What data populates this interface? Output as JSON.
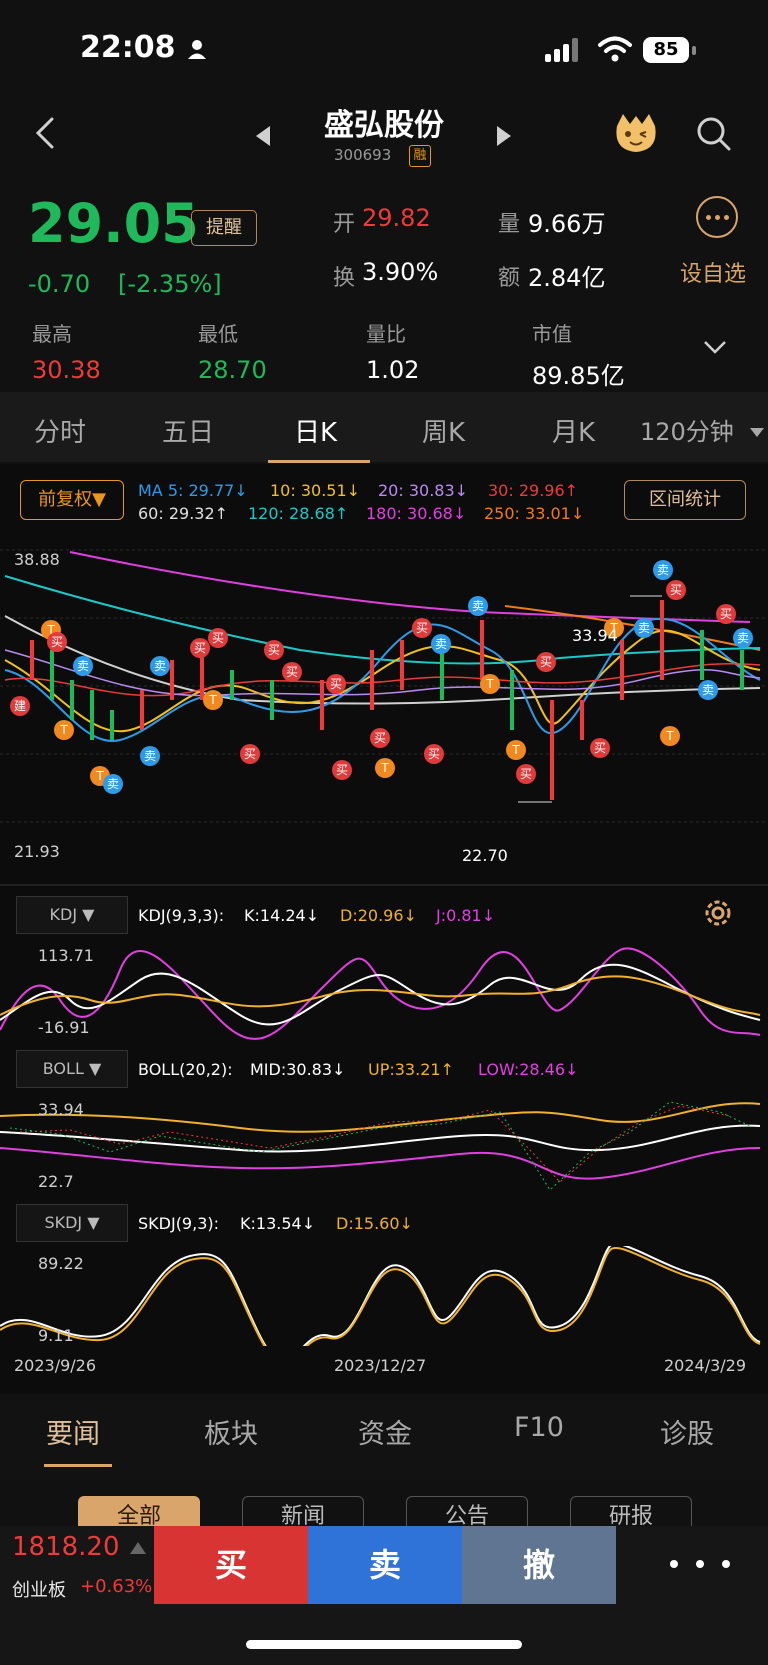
{
  "status_bar": {
    "time": "22:08",
    "battery": "85"
  },
  "header": {
    "name": "盛弘股份",
    "code": "300693",
    "badge": "融"
  },
  "quote": {
    "price": "29.05",
    "alert_label": "提醒",
    "change": "-0.70",
    "change_pct": "[-2.35%]",
    "open_label": "开",
    "open": "29.82",
    "vol_label": "量",
    "vol": "9.66万",
    "turnover_label": "换",
    "turnover": "3.90%",
    "amount_label": "额",
    "amount": "2.84亿",
    "add_watch": "设自选",
    "high_label": "最高",
    "high": "30.38",
    "low_label": "最低",
    "low": "28.70",
    "vr_label": "量比",
    "vr": "1.02",
    "mcap_label": "市值",
    "mcap": "89.85亿"
  },
  "period_tabs": [
    "分时",
    "五日",
    "日K",
    "周K",
    "月K",
    "120分钟"
  ],
  "chart_controls": {
    "adjust": "前复权▼",
    "range_stats": "区间统计"
  },
  "ma_legend": {
    "ma5": "MA 5: 29.77↓",
    "ma10": "10: 30.51↓",
    "ma20": "20: 30.83↓",
    "ma30": "30: 29.96↑",
    "ma60": "60: 29.32↑",
    "ma120": "120: 28.68↑",
    "ma180": "180: 30.68↓",
    "ma250": "250: 33.01↓"
  },
  "main_axis": {
    "top": "38.88",
    "bottom": "21.93",
    "peak": "33.94",
    "trough": "22.70"
  },
  "markers": {
    "buy": "买",
    "sell": "卖",
    "t": "T",
    "build": "建"
  },
  "kdj": {
    "btn": "KDJ ▼",
    "name": "KDJ(9,3,3):",
    "k": "K:14.24↓",
    "d": "D:20.96↓",
    "j": "J:0.81↓",
    "top": "113.71",
    "bottom": "-16.91"
  },
  "boll": {
    "btn": "BOLL ▼",
    "name": "BOLL(20,2):",
    "mid": "MID:30.83↓",
    "up": "UP:33.21↑",
    "low": "LOW:28.46↓",
    "top": "33.94",
    "bottom": "22.7"
  },
  "skdj": {
    "btn": "SKDJ ▼",
    "name": "SKDJ(9,3):",
    "k": "K:13.54↓",
    "d": "D:15.60↓",
    "top": "89.22",
    "bottom": "9.11"
  },
  "dates": {
    "start": "2023/9/26",
    "mid": "2023/12/27",
    "end": "2024/3/29"
  },
  "news_tabs": [
    "要闻",
    "板块",
    "资金",
    "F10",
    "诊股"
  ],
  "news_chips": [
    "全部",
    "新闻",
    "公告",
    "研报"
  ],
  "index": {
    "value": "1818.20",
    "name": "创业板",
    "change": "+0.63%"
  },
  "trade": {
    "buy": "买",
    "sell": "卖",
    "cancel": "撤"
  },
  "colors": {
    "up": "#ee3a3a",
    "down": "#1fb85a",
    "accent": "#d9a56b"
  }
}
